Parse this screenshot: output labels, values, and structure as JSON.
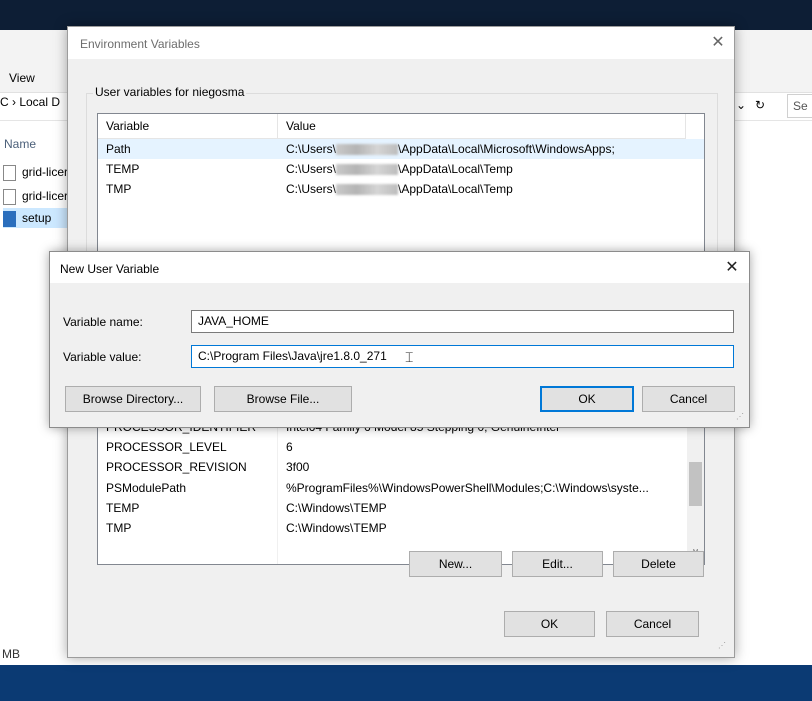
{
  "explorer": {
    "view_tab": "View",
    "address": "C › Local D",
    "search": "Se",
    "name_header": "Name",
    "files": [
      "grid-licer",
      "grid-licer",
      "setup"
    ],
    "status": "MB"
  },
  "env_dialog": {
    "title": "Environment Variables",
    "close_glyph": "✕",
    "user_group_label": "User variables for niegosma",
    "columns": [
      "Variable",
      "Value"
    ],
    "user_vars": [
      {
        "name": "Path",
        "value_prefix": "C:\\Users\\",
        "value_suffix": "\\AppData\\Local\\Microsoft\\WindowsApps;"
      },
      {
        "name": "TEMP",
        "value_prefix": "C:\\Users\\",
        "value_suffix": "\\AppData\\Local\\Temp"
      },
      {
        "name": "TMP",
        "value_prefix": "C:\\Users\\",
        "value_suffix": "\\AppData\\Local\\Temp"
      }
    ],
    "system_vars": [
      {
        "name": "PROCESSOR_IDENTIFIER",
        "value": "Intel64 Family 6 Model 85 Stepping 0, GenuineIntel"
      },
      {
        "name": "PROCESSOR_LEVEL",
        "value": "6"
      },
      {
        "name": "PROCESSOR_REVISION",
        "value": "3f00"
      },
      {
        "name": "PSModulePath",
        "value": "%ProgramFiles%\\WindowsPowerShell\\Modules;C:\\Windows\\syste..."
      },
      {
        "name": "TEMP",
        "value": "C:\\Windows\\TEMP"
      },
      {
        "name": "TMP",
        "value": "C:\\Windows\\TEMP"
      }
    ],
    "buttons": {
      "new": "New...",
      "edit": "Edit...",
      "delete": "Delete",
      "ok": "OK",
      "cancel": "Cancel"
    }
  },
  "new_user_variable": {
    "title": "New User Variable",
    "close_glyph": "✕",
    "name_label": "Variable name:",
    "name_value": "JAVA_HOME",
    "value_label": "Variable value:",
    "value_value": "C:\\Program Files\\Java\\jre1.8.0_271",
    "buttons": {
      "browse_directory": "Browse Directory...",
      "browse_file": "Browse File...",
      "ok": "OK",
      "cancel": "Cancel"
    }
  }
}
